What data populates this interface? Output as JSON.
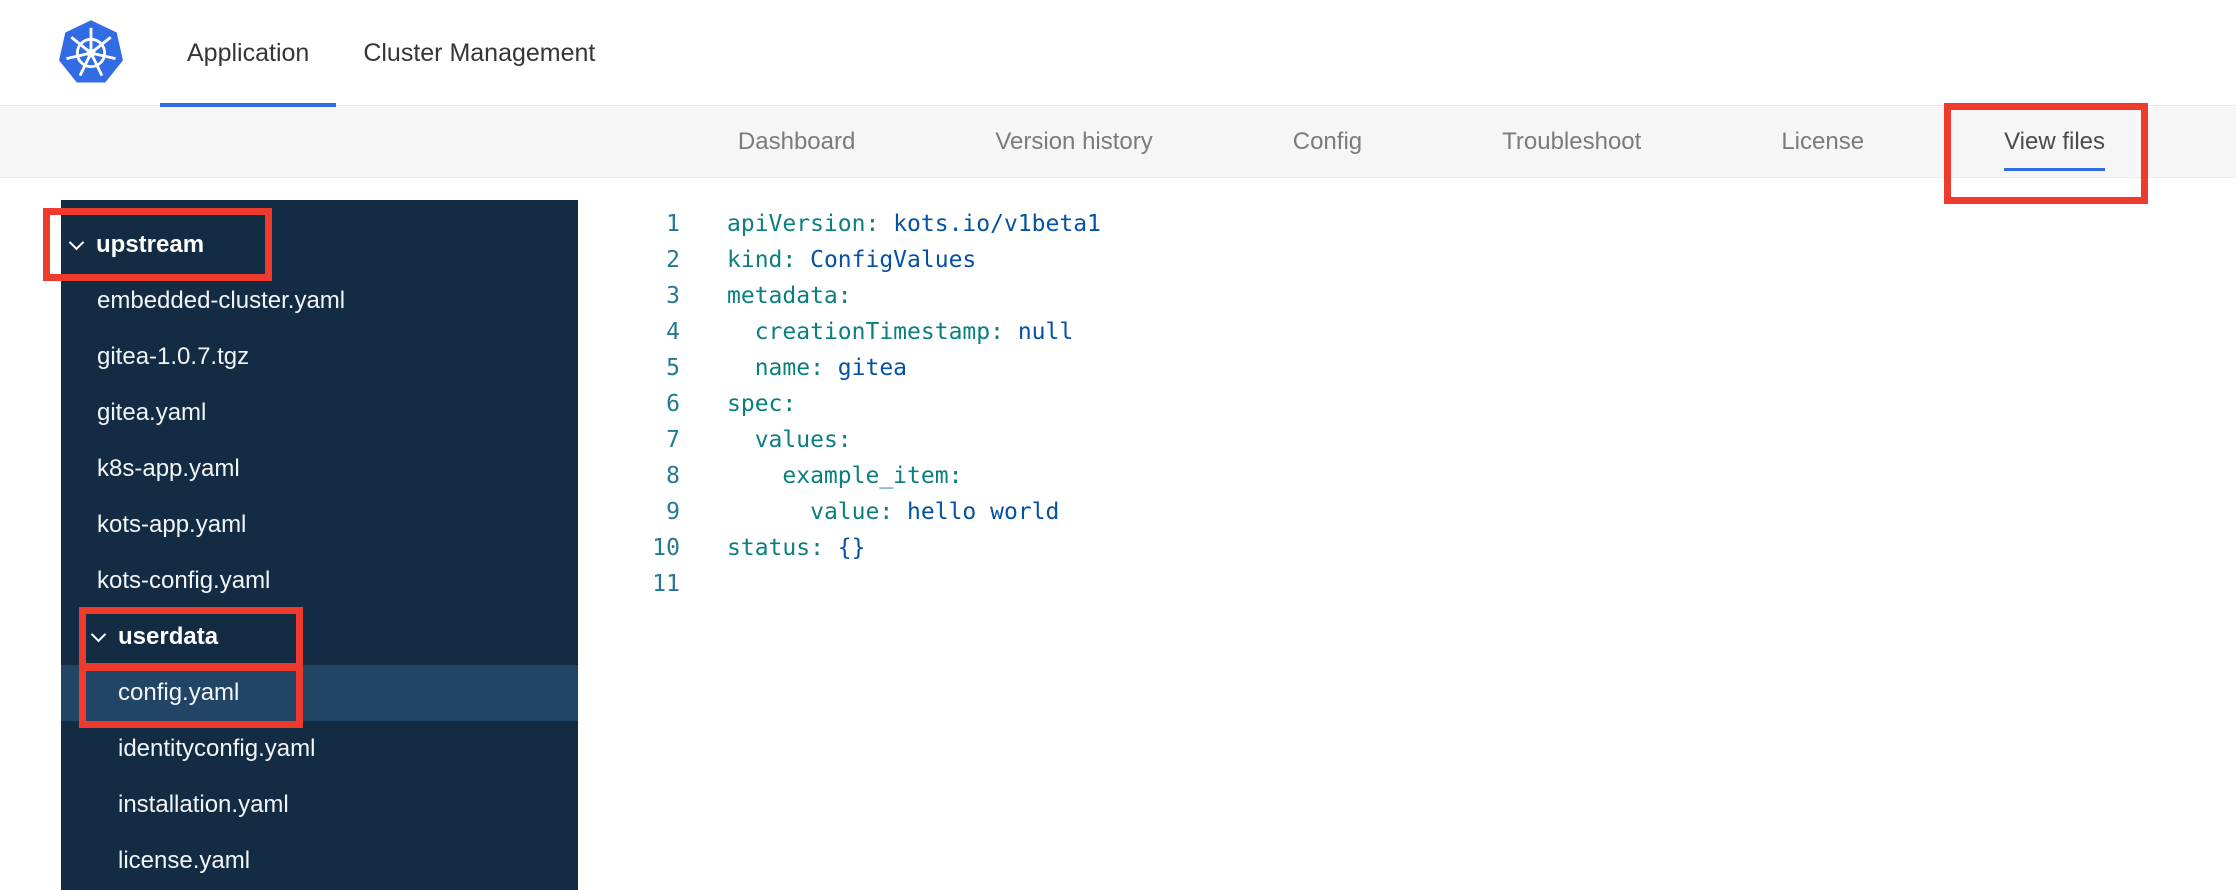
{
  "colors": {
    "accent_blue": "#326de6",
    "kubernetes_blue": "#326ce5",
    "annotation_red": "#ee3b2e",
    "subnav_bg": "#f6f6f6",
    "sidebar_bg": "#132c44",
    "sidebar_selected_bg": "#224566",
    "code_key_teal": "#0b7f7f",
    "code_value_blue": "#0451a5",
    "line_number_blue": "#237893"
  },
  "topnav": {
    "tabs": [
      {
        "label": "Application",
        "active": true
      },
      {
        "label": "Cluster Management",
        "active": false
      }
    ]
  },
  "subnav": {
    "tabs": [
      {
        "label": "Dashboard",
        "active": false,
        "annotated": false
      },
      {
        "label": "Version history",
        "active": false,
        "annotated": false
      },
      {
        "label": "Config",
        "active": false,
        "annotated": false
      },
      {
        "label": "Troubleshoot",
        "active": false,
        "annotated": false
      },
      {
        "label": "License",
        "active": false,
        "annotated": false
      },
      {
        "label": "View files",
        "active": true,
        "annotated": true
      }
    ]
  },
  "file_tree": {
    "items": [
      {
        "label": "upstream",
        "type": "folder",
        "level": 0,
        "expanded": true,
        "selected": false,
        "annotated": true
      },
      {
        "label": "embedded-cluster.yaml",
        "type": "file",
        "level": 1,
        "selected": false,
        "annotated": false
      },
      {
        "label": "gitea-1.0.7.tgz",
        "type": "file",
        "level": 1,
        "selected": false,
        "annotated": false
      },
      {
        "label": "gitea.yaml",
        "type": "file",
        "level": 1,
        "selected": false,
        "annotated": false
      },
      {
        "label": "k8s-app.yaml",
        "type": "file",
        "level": 1,
        "selected": false,
        "annotated": false
      },
      {
        "label": "kots-app.yaml",
        "type": "file",
        "level": 1,
        "selected": false,
        "annotated": false
      },
      {
        "label": "kots-config.yaml",
        "type": "file",
        "level": 1,
        "selected": false,
        "annotated": false
      },
      {
        "label": "userdata",
        "type": "folder",
        "level": 1,
        "expanded": true,
        "selected": false,
        "annotated": true
      },
      {
        "label": "config.yaml",
        "type": "file",
        "level": 2,
        "selected": true,
        "annotated": true
      },
      {
        "label": "identityconfig.yaml",
        "type": "file",
        "level": 2,
        "selected": false,
        "annotated": false
      },
      {
        "label": "installation.yaml",
        "type": "file",
        "level": 2,
        "selected": false,
        "annotated": false
      },
      {
        "label": "license.yaml",
        "type": "file",
        "level": 2,
        "selected": false,
        "annotated": false
      }
    ]
  },
  "editor": {
    "language": "yaml",
    "lines": [
      {
        "num": 1,
        "tokens": [
          [
            "k",
            "apiVersion"
          ],
          [
            "p",
            ": "
          ],
          [
            "v",
            "kots.io/v1beta1"
          ]
        ]
      },
      {
        "num": 2,
        "tokens": [
          [
            "k",
            "kind"
          ],
          [
            "p",
            ": "
          ],
          [
            "v",
            "ConfigValues"
          ]
        ]
      },
      {
        "num": 3,
        "tokens": [
          [
            "k",
            "metadata"
          ],
          [
            "p",
            ":"
          ]
        ]
      },
      {
        "num": 4,
        "tokens": [
          [
            "w",
            "  "
          ],
          [
            "k",
            "creationTimestamp"
          ],
          [
            "p",
            ": "
          ],
          [
            "v",
            "null"
          ]
        ]
      },
      {
        "num": 5,
        "tokens": [
          [
            "w",
            "  "
          ],
          [
            "k",
            "name"
          ],
          [
            "p",
            ": "
          ],
          [
            "v",
            "gitea"
          ]
        ]
      },
      {
        "num": 6,
        "tokens": [
          [
            "k",
            "spec"
          ],
          [
            "p",
            ":"
          ]
        ]
      },
      {
        "num": 7,
        "tokens": [
          [
            "w",
            "  "
          ],
          [
            "k",
            "values"
          ],
          [
            "p",
            ":"
          ]
        ]
      },
      {
        "num": 8,
        "tokens": [
          [
            "w",
            "    "
          ],
          [
            "k",
            "example_item"
          ],
          [
            "p",
            ":"
          ]
        ]
      },
      {
        "num": 9,
        "tokens": [
          [
            "w",
            "      "
          ],
          [
            "k",
            "value"
          ],
          [
            "p",
            ": "
          ],
          [
            "v",
            "hello world"
          ]
        ]
      },
      {
        "num": 10,
        "tokens": [
          [
            "k",
            "status"
          ],
          [
            "p",
            ": "
          ],
          [
            "v",
            "{}"
          ]
        ]
      },
      {
        "num": 11,
        "tokens": []
      }
    ]
  }
}
